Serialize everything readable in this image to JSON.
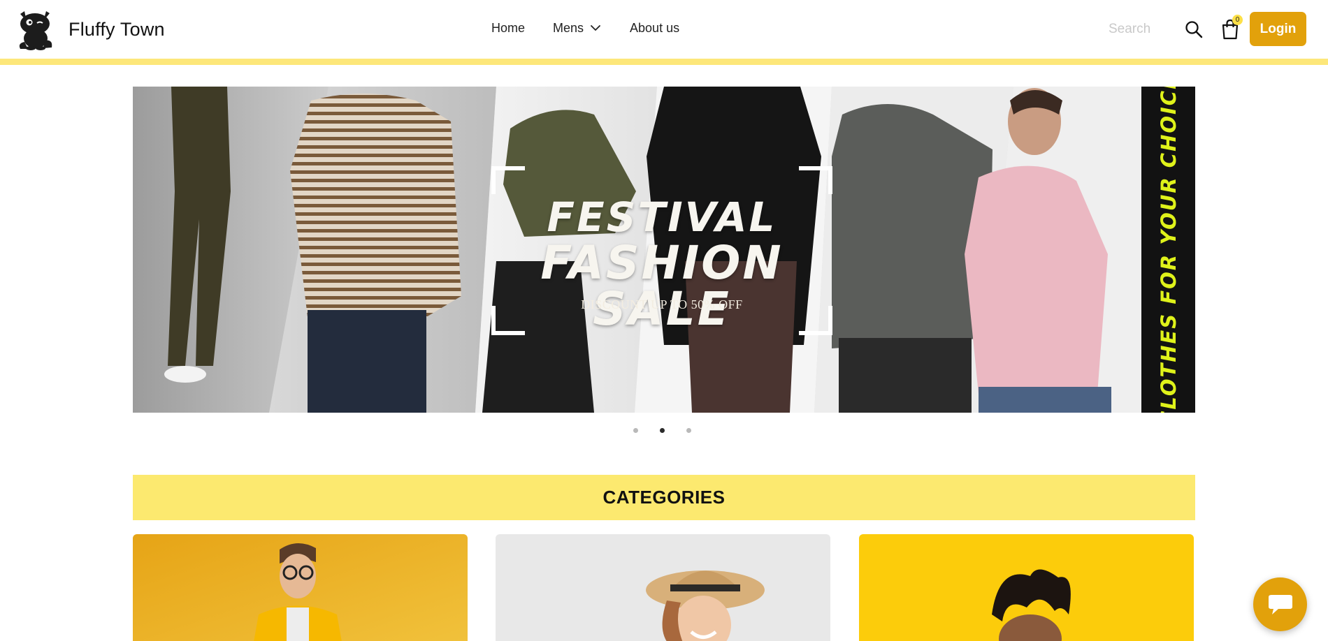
{
  "header": {
    "brand_name": "Fluffy Town",
    "nav": {
      "home": "Home",
      "mens": "Mens",
      "about": "About us"
    },
    "search": {
      "placeholder": "Search",
      "value": ""
    },
    "cart_count": "0",
    "login_label": "Login"
  },
  "hero": {
    "title_line1": "FESTIVAL",
    "title_line2": "FASHION SALE",
    "subtitle": "DISCOUNT UP TO 50% OFF",
    "side_text": "“CLOTHES FOR YOUR CHOICE”",
    "slide_count": 3,
    "active_slide": 2
  },
  "categories": {
    "title": "CATEGORIES"
  },
  "colors": {
    "accent": "#e2a10b",
    "highlight_yellow": "#fce96f",
    "header_stripe": "#fde77a",
    "side_text": "#dff21a"
  },
  "icons": [
    "cat-logo-icon",
    "chevron-down-icon",
    "search-icon",
    "shopping-bag-icon",
    "chat-icon"
  ]
}
